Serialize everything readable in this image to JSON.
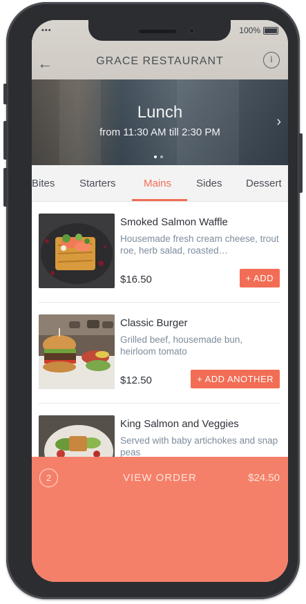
{
  "status_bar": {
    "signal": "•••",
    "battery": "100%"
  },
  "nav": {
    "back_icon": "←",
    "title": "GRACE RESTAURANT",
    "info_icon": "i"
  },
  "hero": {
    "meal": "Lunch",
    "hours": "from 11:30 AM till 2:30 PM",
    "next_icon": "›",
    "page_count": 2,
    "current_page": 1
  },
  "tabs": [
    {
      "label": "Bites"
    },
    {
      "label": "Starters"
    },
    {
      "label": "Mains"
    },
    {
      "label": "Sides"
    },
    {
      "label": "Dessert"
    }
  ],
  "active_tab": "Mains",
  "menu_items": [
    {
      "name": "Smoked Salmon Waffle",
      "description": "Housemade fresh cream cheese, trout roe, herb salad, roasted…",
      "price": "$16.50",
      "button": "+ ADD"
    },
    {
      "name": "Classic Burger",
      "description": "Grilled beef, housemade bun, heirloom tomato",
      "price": "$12.50",
      "button": "+ ADD ANOTHER"
    },
    {
      "name": "King Salmon and Veggies",
      "description": "Served with baby artichokes and snap peas",
      "price": "",
      "button": ""
    }
  ],
  "order_bar": {
    "count": "2",
    "label": "VIEW ORDER",
    "total": "$24.50"
  },
  "colors": {
    "accent": "#f26d55",
    "order_bar": "#f58069"
  }
}
